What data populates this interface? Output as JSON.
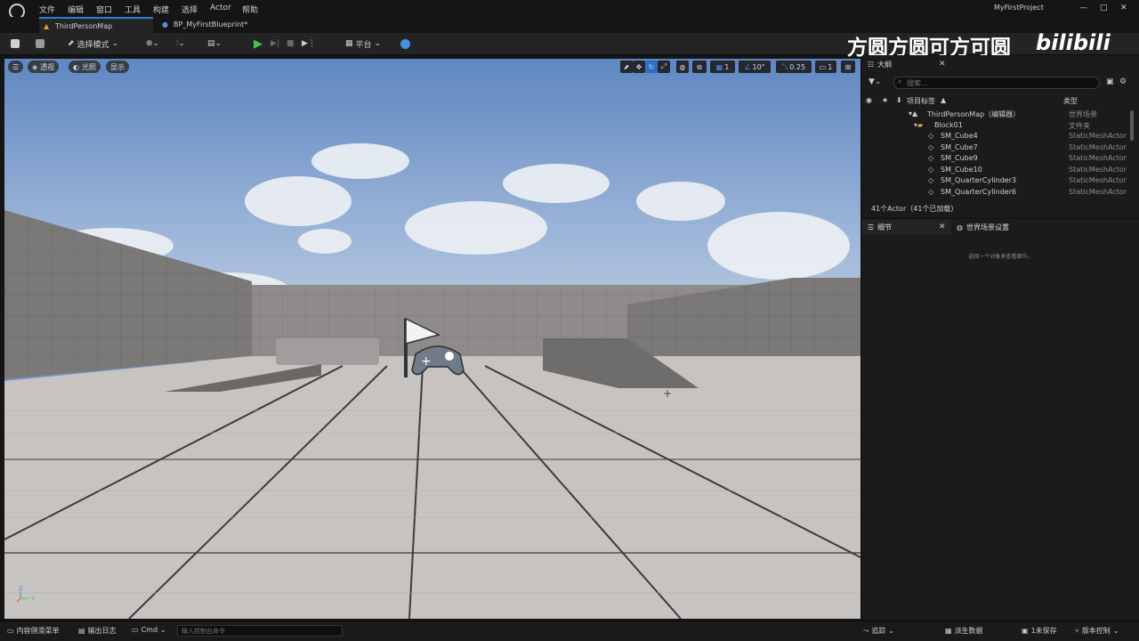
{
  "menu": [
    "文件",
    "编辑",
    "窗口",
    "工具",
    "构建",
    "选择",
    "Actor",
    "帮助"
  ],
  "project_name": "MyFirstProject",
  "tabs": [
    {
      "label": "ThirdPersonMap",
      "active": true
    },
    {
      "label": "BP_MyFirstBlueprint*",
      "active": false
    }
  ],
  "toolbar": {
    "select_mode": "选择模式",
    "platform": "平台"
  },
  "watermark": "方圆方圆可方可圆",
  "watermark_logo": "bilibili",
  "viewport": {
    "perspective": "透视",
    "lighting": "光照",
    "show": "显示",
    "grid_value": "1",
    "angle_value": "10°",
    "scale_value": "0.25",
    "camera_speed": "1"
  },
  "outliner": {
    "title": "大纲",
    "search_placeholder": "搜索...",
    "col_label": "项目标签",
    "col_type": "类型",
    "rows": [
      {
        "label": "ThirdPersonMap（编辑器）",
        "type": "世界场景"
      },
      {
        "label": "Block01",
        "type": "文件夹"
      },
      {
        "label": "SM_Cube4",
        "type": "StaticMeshActor"
      },
      {
        "label": "SM_Cube7",
        "type": "StaticMeshActor"
      },
      {
        "label": "SM_Cube9",
        "type": "StaticMeshActor"
      },
      {
        "label": "SM_Cube10",
        "type": "StaticMeshActor"
      },
      {
        "label": "SM_QuarterCylinder3",
        "type": "StaticMeshActor"
      },
      {
        "label": "SM_QuarterCylinder6",
        "type": "StaticMeshActor"
      }
    ],
    "actor_count": "41个Actor（41个已加载）"
  },
  "details": {
    "tab_details": "细节",
    "tab_world": "世界场景设置",
    "empty_msg": "选择一个对象来查看细节。"
  },
  "statusbar": {
    "content_drawer": "内容侧滑菜单",
    "output_log": "输出日志",
    "cmd": "Cmd",
    "cmd_placeholder": "输入控制台命令",
    "trace": "追踪",
    "derived_data": "派生数据",
    "unsaved": "1未保存",
    "source_control": "版本控制"
  }
}
